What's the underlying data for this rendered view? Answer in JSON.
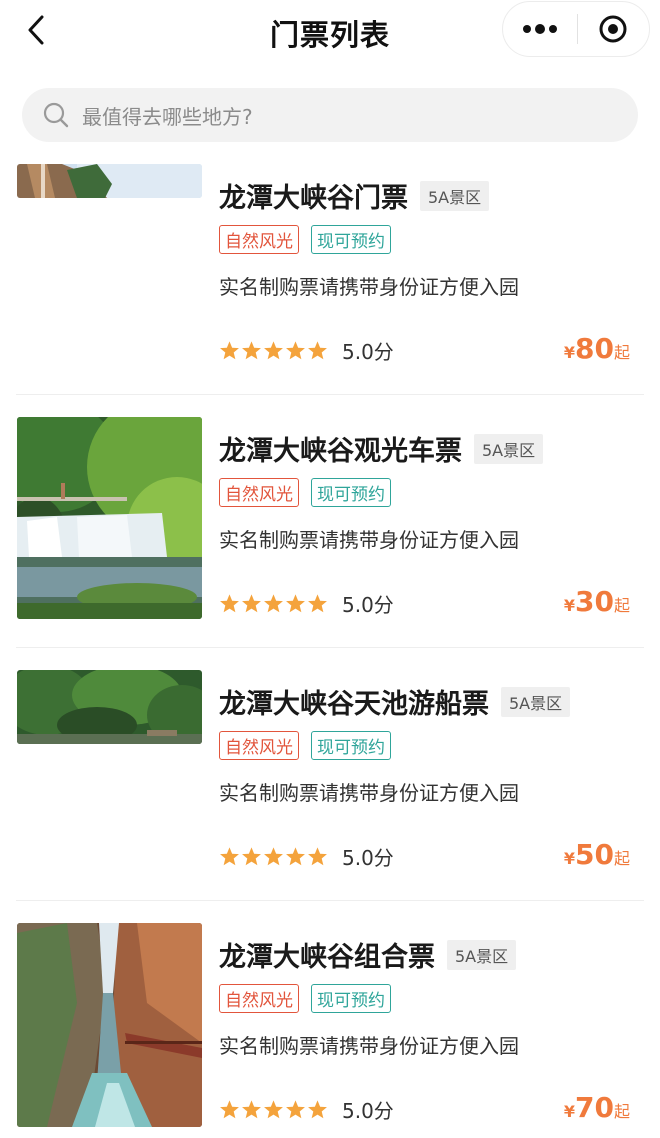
{
  "header": {
    "title": "门票列表",
    "back_icon": "chevron-left-icon",
    "more_icon": "more-dots-icon",
    "close_icon": "target-circle-icon"
  },
  "search": {
    "placeholder": "最值得去哪些地方?",
    "icon": "search-icon"
  },
  "colors": {
    "price": "#f07a3c",
    "tag_scenery": "#e2553c",
    "tag_bookable": "#2fa59a",
    "star": "#f4a33c"
  },
  "tickets": [
    {
      "name": "龙潭大峡谷门票",
      "grade": "5A景区",
      "tags": [
        "自然风光",
        "现可预约"
      ],
      "desc": "实名制购票请携带身份证方便入园",
      "stars": 5,
      "score": "5.0分",
      "currency": "¥",
      "price": "80",
      "price_suffix": "起"
    },
    {
      "name": "龙潭大峡谷观光车票",
      "grade": "5A景区",
      "tags": [
        "自然风光",
        "现可预约"
      ],
      "desc": "实名制购票请携带身份证方便入园",
      "stars": 5,
      "score": "5.0分",
      "currency": "¥",
      "price": "30",
      "price_suffix": "起"
    },
    {
      "name": "龙潭大峡谷天池游船票",
      "grade": "5A景区",
      "tags": [
        "自然风光",
        "现可预约"
      ],
      "desc": "实名制购票请携带身份证方便入园",
      "stars": 5,
      "score": "5.0分",
      "currency": "¥",
      "price": "50",
      "price_suffix": "起"
    },
    {
      "name": "龙潭大峡谷组合票",
      "grade": "5A景区",
      "tags": [
        "自然风光",
        "现可预约"
      ],
      "desc": "实名制购票请携带身份证方便入园",
      "stars": 5,
      "score": "5.0分",
      "currency": "¥",
      "price": "70",
      "price_suffix": "起"
    }
  ]
}
